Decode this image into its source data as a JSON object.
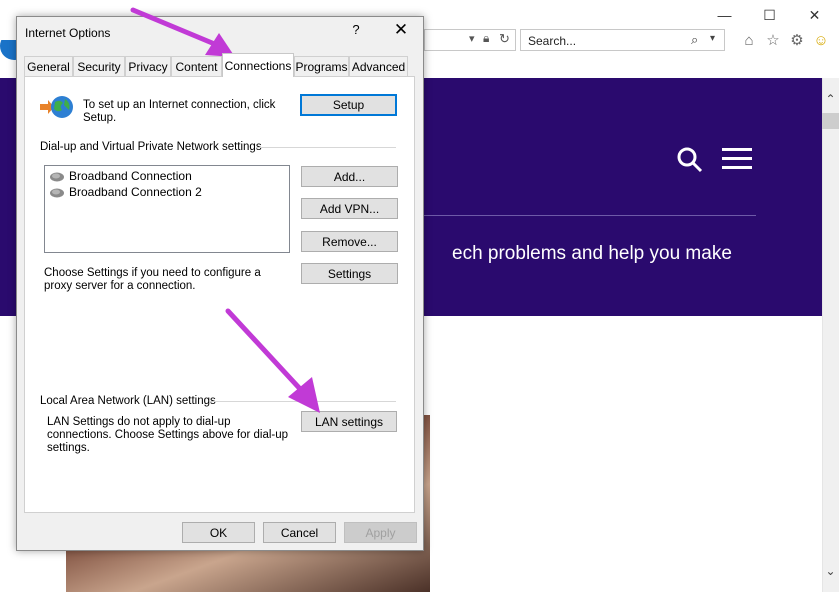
{
  "browser": {
    "window_controls": {
      "minimize": "—",
      "maximize": "☐",
      "close": "✕"
    },
    "search_placeholder": "Search...",
    "hero_text": "ech problems and help you make"
  },
  "dialog": {
    "title": "Internet Options",
    "help": "?",
    "close": "✕",
    "tabs": [
      "General",
      "Security",
      "Privacy",
      "Content",
      "Connections",
      "Programs",
      "Advanced"
    ],
    "active_tab": "Connections",
    "setup_text": "To set up an Internet connection, click Setup.",
    "setup_button": "Setup",
    "dialup_group": "Dial-up and Virtual Private Network settings",
    "connections": [
      "Broadband Connection",
      "Broadband Connection 2"
    ],
    "add_button": "Add...",
    "add_vpn_button": "Add VPN...",
    "remove_button": "Remove...",
    "proxy_text": "Choose Settings if you need to configure a proxy server for a connection.",
    "settings_button": "Settings",
    "lan_group": "Local Area Network (LAN) settings",
    "lan_text": "LAN Settings do not apply to dial-up connections. Choose Settings above for dial-up settings.",
    "lan_button": "LAN settings",
    "ok_button": "OK",
    "cancel_button": "Cancel",
    "apply_button": "Apply"
  },
  "colors": {
    "hero_bg": "#2a0a6e",
    "annotation_arrow": "#c13ad6"
  }
}
